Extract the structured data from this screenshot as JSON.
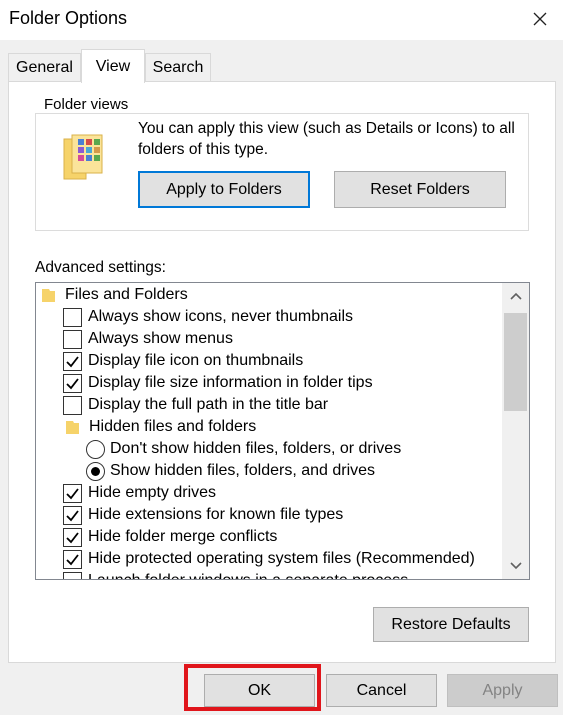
{
  "window": {
    "title": "Folder Options"
  },
  "tabs": [
    {
      "label": "General",
      "active": false
    },
    {
      "label": "View",
      "active": true
    },
    {
      "label": "Search",
      "active": false
    }
  ],
  "folder_views": {
    "title": "Folder views",
    "description": "You can apply this view (such as Details or Icons) to all folders of this type.",
    "apply_label": "Apply to Folders",
    "reset_label": "Reset Folders"
  },
  "advanced": {
    "label": "Advanced settings:",
    "items": [
      {
        "type": "folder",
        "label": "Files and Folders"
      },
      {
        "type": "checkbox",
        "label": "Always show icons, never thumbnails",
        "checked": false
      },
      {
        "type": "checkbox",
        "label": "Always show menus",
        "checked": false
      },
      {
        "type": "checkbox",
        "label": "Display file icon on thumbnails",
        "checked": true
      },
      {
        "type": "checkbox",
        "label": "Display file size information in folder tips",
        "checked": true
      },
      {
        "type": "checkbox",
        "label": "Display the full path in the title bar",
        "checked": false
      },
      {
        "type": "folder",
        "label": "Hidden files and folders"
      },
      {
        "type": "radio",
        "label": "Don't show hidden files, folders, or drives",
        "checked": false
      },
      {
        "type": "radio",
        "label": "Show hidden files, folders, and drives",
        "checked": true
      },
      {
        "type": "checkbox",
        "label": "Hide empty drives",
        "checked": true
      },
      {
        "type": "checkbox",
        "label": "Hide extensions for known file types",
        "checked": true
      },
      {
        "type": "checkbox",
        "label": "Hide folder merge conflicts",
        "checked": true
      },
      {
        "type": "checkbox",
        "label": "Hide protected operating system files (Recommended)",
        "checked": true
      },
      {
        "type": "checkbox",
        "label": "Launch folder windows in a separate process",
        "checked": false
      }
    ],
    "restore_label": "Restore Defaults"
  },
  "footer": {
    "ok_label": "OK",
    "cancel_label": "Cancel",
    "apply_label": "Apply"
  },
  "colors": {
    "highlight": "#e0151b",
    "focus": "#0078d7",
    "folder": "#f6d36a"
  }
}
